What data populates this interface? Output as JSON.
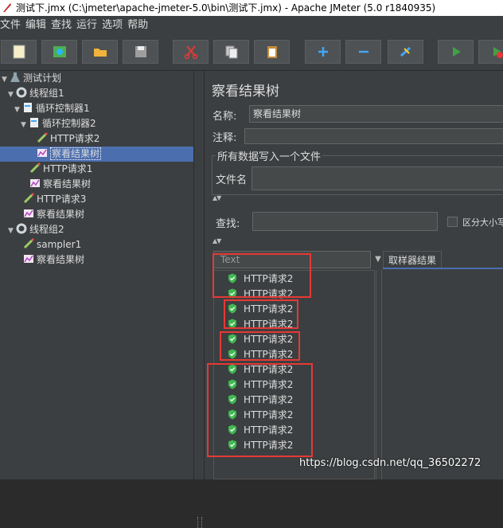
{
  "window": {
    "title": "测试下.jmx (C:\\jmeter\\apache-jmeter-5.0\\bin\\测试下.jmx) - Apache JMeter (5.0 r1840935)"
  },
  "menu": [
    "文件",
    "编辑",
    "查找",
    "运行",
    "选项",
    "帮助"
  ],
  "toolbar": {
    "buttons": [
      "new-icon",
      "templates-icon",
      "open-icon",
      "save-icon",
      "cut-icon",
      "copy-icon",
      "paste-icon",
      "expand-icon",
      "collapse-icon",
      "toggle-icon",
      "start-icon",
      "start-no-pause-icon"
    ]
  },
  "tree": {
    "items": [
      {
        "label": "测试计划",
        "icon": "test-plan-icon"
      },
      {
        "label": "线程组1",
        "icon": "thread-group-icon"
      },
      {
        "label": "循环控制器1",
        "icon": "loop-controller-icon"
      },
      {
        "label": "循环控制器2",
        "icon": "loop-controller-icon"
      },
      {
        "label": "HTTP请求2",
        "icon": "sampler-icon"
      },
      {
        "label": "察看结果树",
        "icon": "listener-icon",
        "selected": true
      },
      {
        "label": "HTTP请求1",
        "icon": "sampler-icon"
      },
      {
        "label": "察看结果树",
        "icon": "listener-icon"
      },
      {
        "label": "HTTP请求3",
        "icon": "sampler-icon"
      },
      {
        "label": "察看结果树",
        "icon": "listener-icon"
      },
      {
        "label": "线程组2",
        "icon": "thread-group-icon"
      },
      {
        "label": "sampler1",
        "icon": "sampler-icon"
      },
      {
        "label": "察看结果树",
        "icon": "listener-icon"
      }
    ]
  },
  "panel": {
    "title": "察看结果树",
    "name_label": "名称:",
    "name_value": "察看结果树",
    "comment_label": "注释:",
    "comment_value": "",
    "group_label": "所有数据写入一个文件",
    "filename_label": "文件名",
    "filename_value": "",
    "search_label": "查找:",
    "search_value": "",
    "case_sensitive_label": "区分大小写",
    "renderer_value": "Text",
    "tab_label": "取样器结果"
  },
  "results": [
    "HTTP请求2",
    "HTTP请求2",
    "HTTP请求2",
    "HTTP请求2",
    "HTTP请求2",
    "HTTP请求2",
    "HTTP请求2",
    "HTTP请求2",
    "HTTP请求2",
    "HTTP请求2",
    "HTTP请求2",
    "HTTP请求2"
  ],
  "colors": {
    "selection": "#4b6eaf",
    "annotation_box": "#e53935",
    "success": "#3fb950"
  },
  "watermark": "https://blog.csdn.net/qq_36502272"
}
